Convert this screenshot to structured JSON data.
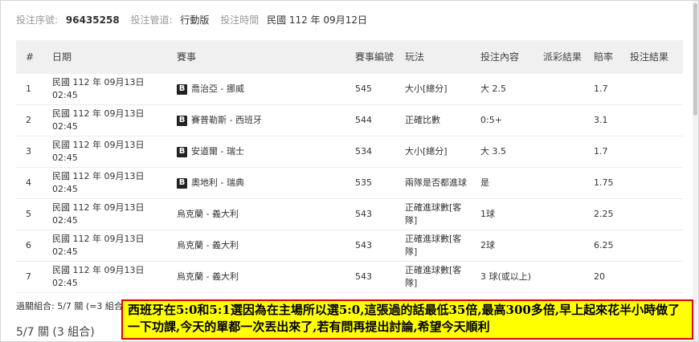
{
  "meta": {
    "serial_label": "投注序號",
    "serial_value": "96435258",
    "channel_label": "投注管道:",
    "channel_value": "行動版",
    "time_label": "投注時間",
    "time_value": "民國 112 年 09月12日"
  },
  "table": {
    "headers": [
      "#",
      "日期",
      "賽事",
      "賽事編號",
      "玩法",
      "投注內容",
      "派彩結果",
      "賠率",
      "投注結果"
    ],
    "rows": [
      {
        "num": "1",
        "date": "民國 112 年 09月13日",
        "time": "02:45",
        "badge": "B",
        "match": "喬治亞 - 挪威",
        "code": "545",
        "play": "大小[總分]",
        "content": "大 2.5",
        "odds": "1.7"
      },
      {
        "num": "2",
        "date": "民國 112 年 09月13日",
        "time": "02:45",
        "badge": "B",
        "match": "賽普勒斯 - 西班牙",
        "code": "544",
        "play": "正確比數",
        "content": "0:5+",
        "odds": "3.1"
      },
      {
        "num": "3",
        "date": "民國 112 年 09月13日",
        "time": "02:45",
        "badge": "B",
        "match": "安道爾 - 瑞士",
        "code": "534",
        "play": "大小[總分]",
        "content": "大 3.5",
        "odds": "1.7"
      },
      {
        "num": "4",
        "date": "民國 112 年 09月13日",
        "time": "02:45",
        "badge": "B",
        "match": "奧地利 - 瑞典",
        "code": "535",
        "play": "兩隊是否都進球",
        "content": "是",
        "odds": "1.75"
      },
      {
        "num": "5",
        "date": "民國 112 年 09月13日",
        "time": "02:45",
        "badge": "",
        "match": "烏克蘭 - 義大利",
        "code": "543",
        "play": "正確進球數[客隊]",
        "content": "1球",
        "odds": "2.25"
      },
      {
        "num": "6",
        "date": "民國 112 年 09月13日",
        "time": "02:45",
        "badge": "",
        "match": "烏克蘭 - 義大利",
        "code": "543",
        "play": "正確進球數[客隊]",
        "content": "2球",
        "odds": "6.25"
      },
      {
        "num": "7",
        "date": "民國 112 年 09月13日",
        "time": "02:45",
        "badge": "",
        "match": "烏克蘭 - 義大利",
        "code": "543",
        "play": "正確進球數[客隊]",
        "content": "3 球(或以上)",
        "odds": "20"
      }
    ]
  },
  "footer": {
    "combo_small": "過關組合: 5/7 關 (=3 組合",
    "combo_big": "5/7 關 (3 組合)"
  },
  "note": {
    "text": "西班牙在5:0和5:1選因為在主場所以選5:0,這張過的話最低35倍,最高300多倍,早上起來花半小時做了一下功課,今天的單都一次丟出來了,若有問再提出討論,希望今天順利"
  }
}
